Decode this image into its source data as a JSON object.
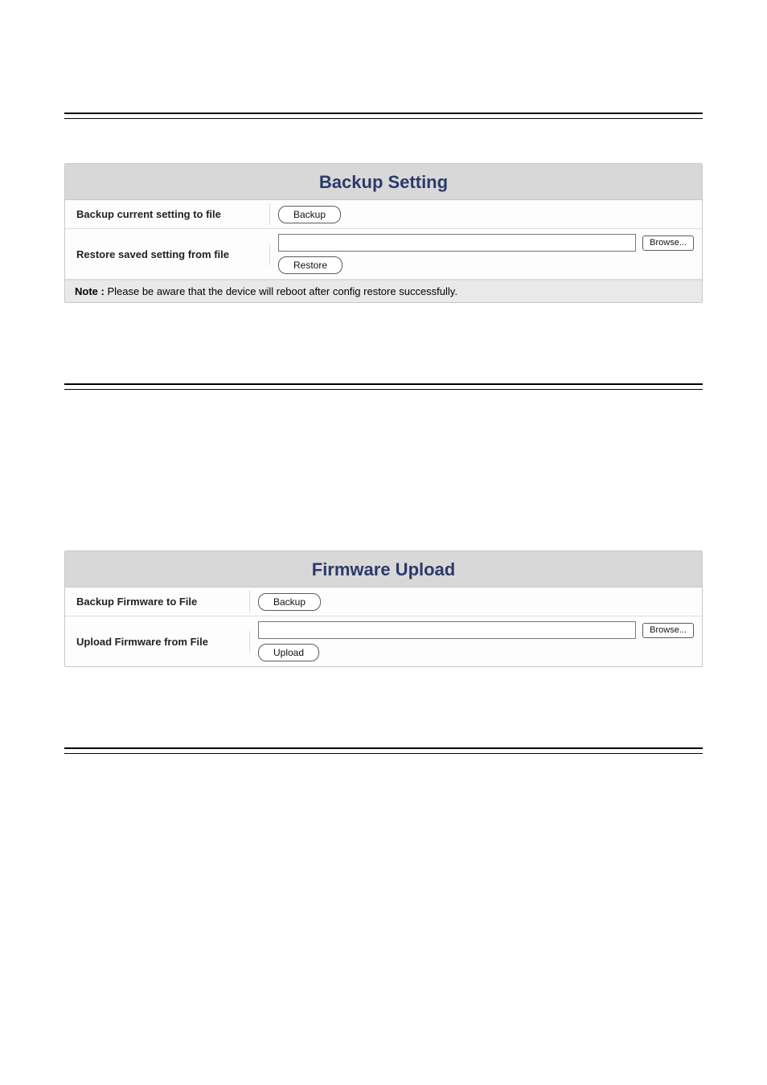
{
  "backup_panel": {
    "title": "Backup Setting",
    "row1_label": "Backup current setting to file",
    "row1_button": "Backup",
    "row2_label": "Restore saved setting from file",
    "row2_browse": "Browse...",
    "row2_button": "Restore",
    "note_label": "Note :",
    "note_text": " Please be aware that the device will reboot after config restore successfully."
  },
  "firmware_panel": {
    "title": "Firmware Upload",
    "row1_label": "Backup Firmware to File",
    "row1_button": "Backup",
    "row2_label": "Upload Firmware from File",
    "row2_browse": "Browse...",
    "row2_button": "Upload"
  }
}
